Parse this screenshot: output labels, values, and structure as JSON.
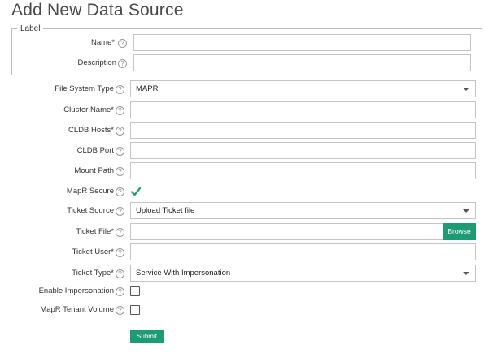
{
  "page": {
    "title": "Add New Data Source"
  },
  "label_group": {
    "legend": "Label",
    "name_label": "Name*",
    "description_label": "Description",
    "name_value": "",
    "description_value": ""
  },
  "form": {
    "file_system_type": {
      "label": "File System Type",
      "value": "MAPR"
    },
    "cluster_name": {
      "label": "Cluster Name*",
      "value": ""
    },
    "cldb_hosts": {
      "label": "CLDB Hosts*",
      "value": ""
    },
    "cldb_port": {
      "label": "CLDB Port",
      "value": ""
    },
    "mount_path": {
      "label": "Mount Path",
      "value": ""
    },
    "mapr_secure": {
      "label": "MapR Secure",
      "checked": true
    },
    "ticket_source": {
      "label": "Ticket Source",
      "value": "Upload Ticket file"
    },
    "ticket_file": {
      "label": "Ticket File*",
      "value": "",
      "browse_label": "Browse"
    },
    "ticket_user": {
      "label": "Ticket User*",
      "value": ""
    },
    "ticket_type": {
      "label": "Ticket Type*",
      "value": "Service With Impersonation"
    },
    "enable_impersonation": {
      "label": "Enable Impersonation",
      "checked": false
    },
    "mapr_tenant_volume": {
      "label": "MapR Tenant Volume",
      "checked": false
    }
  },
  "actions": {
    "submit_label": "Submit"
  },
  "colors": {
    "accent": "#1e9b74",
    "border": "#c4c4c4",
    "text": "#333333"
  },
  "icons": {
    "help": "help-icon",
    "check": "checkmark-icon",
    "caret": "chevron-down-icon"
  }
}
